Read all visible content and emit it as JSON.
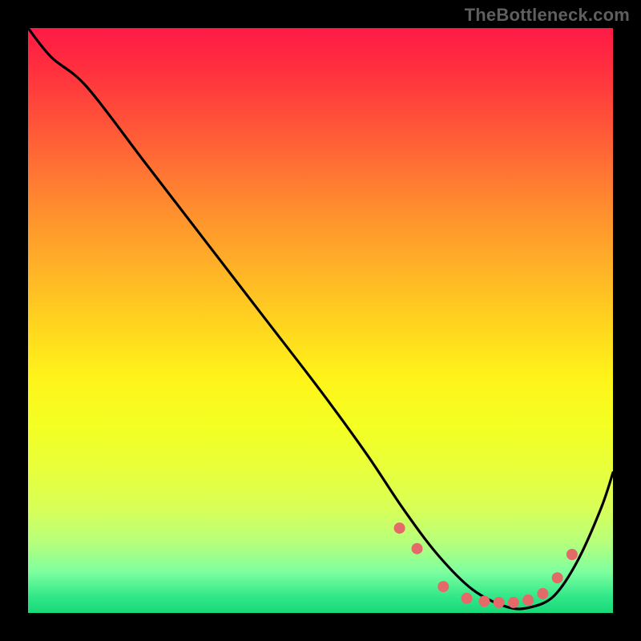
{
  "watermark": "TheBottleneck.com",
  "chart_data": {
    "type": "line",
    "title": "",
    "xlabel": "",
    "ylabel": "",
    "xlim": [
      0,
      100
    ],
    "ylim": [
      0,
      100
    ],
    "grid": false,
    "legend": false,
    "background_gradient": {
      "orientation": "vertical",
      "stops": [
        {
          "pos": 0.0,
          "color": "#ff1a46"
        },
        {
          "pos": 0.5,
          "color": "#ffd21f"
        },
        {
          "pos": 0.82,
          "color": "#d9ff56"
        },
        {
          "pos": 1.0,
          "color": "#17d877"
        }
      ]
    },
    "series": [
      {
        "name": "curve",
        "color": "#000000",
        "x": [
          0,
          4,
          10,
          20,
          30,
          40,
          50,
          58,
          64,
          70,
          76,
          82,
          86,
          90,
          94,
          98,
          100
        ],
        "y": [
          100,
          95,
          90,
          77,
          64,
          51,
          38,
          27,
          18,
          10,
          4,
          1,
          1,
          3,
          9,
          18,
          24
        ]
      }
    ],
    "markers": {
      "name": "dots",
      "color": "#e46a6a",
      "radius": 7,
      "x": [
        63.5,
        66.5,
        71,
        75,
        78,
        80.5,
        83,
        85.5,
        88,
        90.5,
        93
      ],
      "y": [
        14.5,
        11,
        4.5,
        2.5,
        2.0,
        1.8,
        1.8,
        2.2,
        3.3,
        6.0,
        10.0
      ]
    }
  }
}
